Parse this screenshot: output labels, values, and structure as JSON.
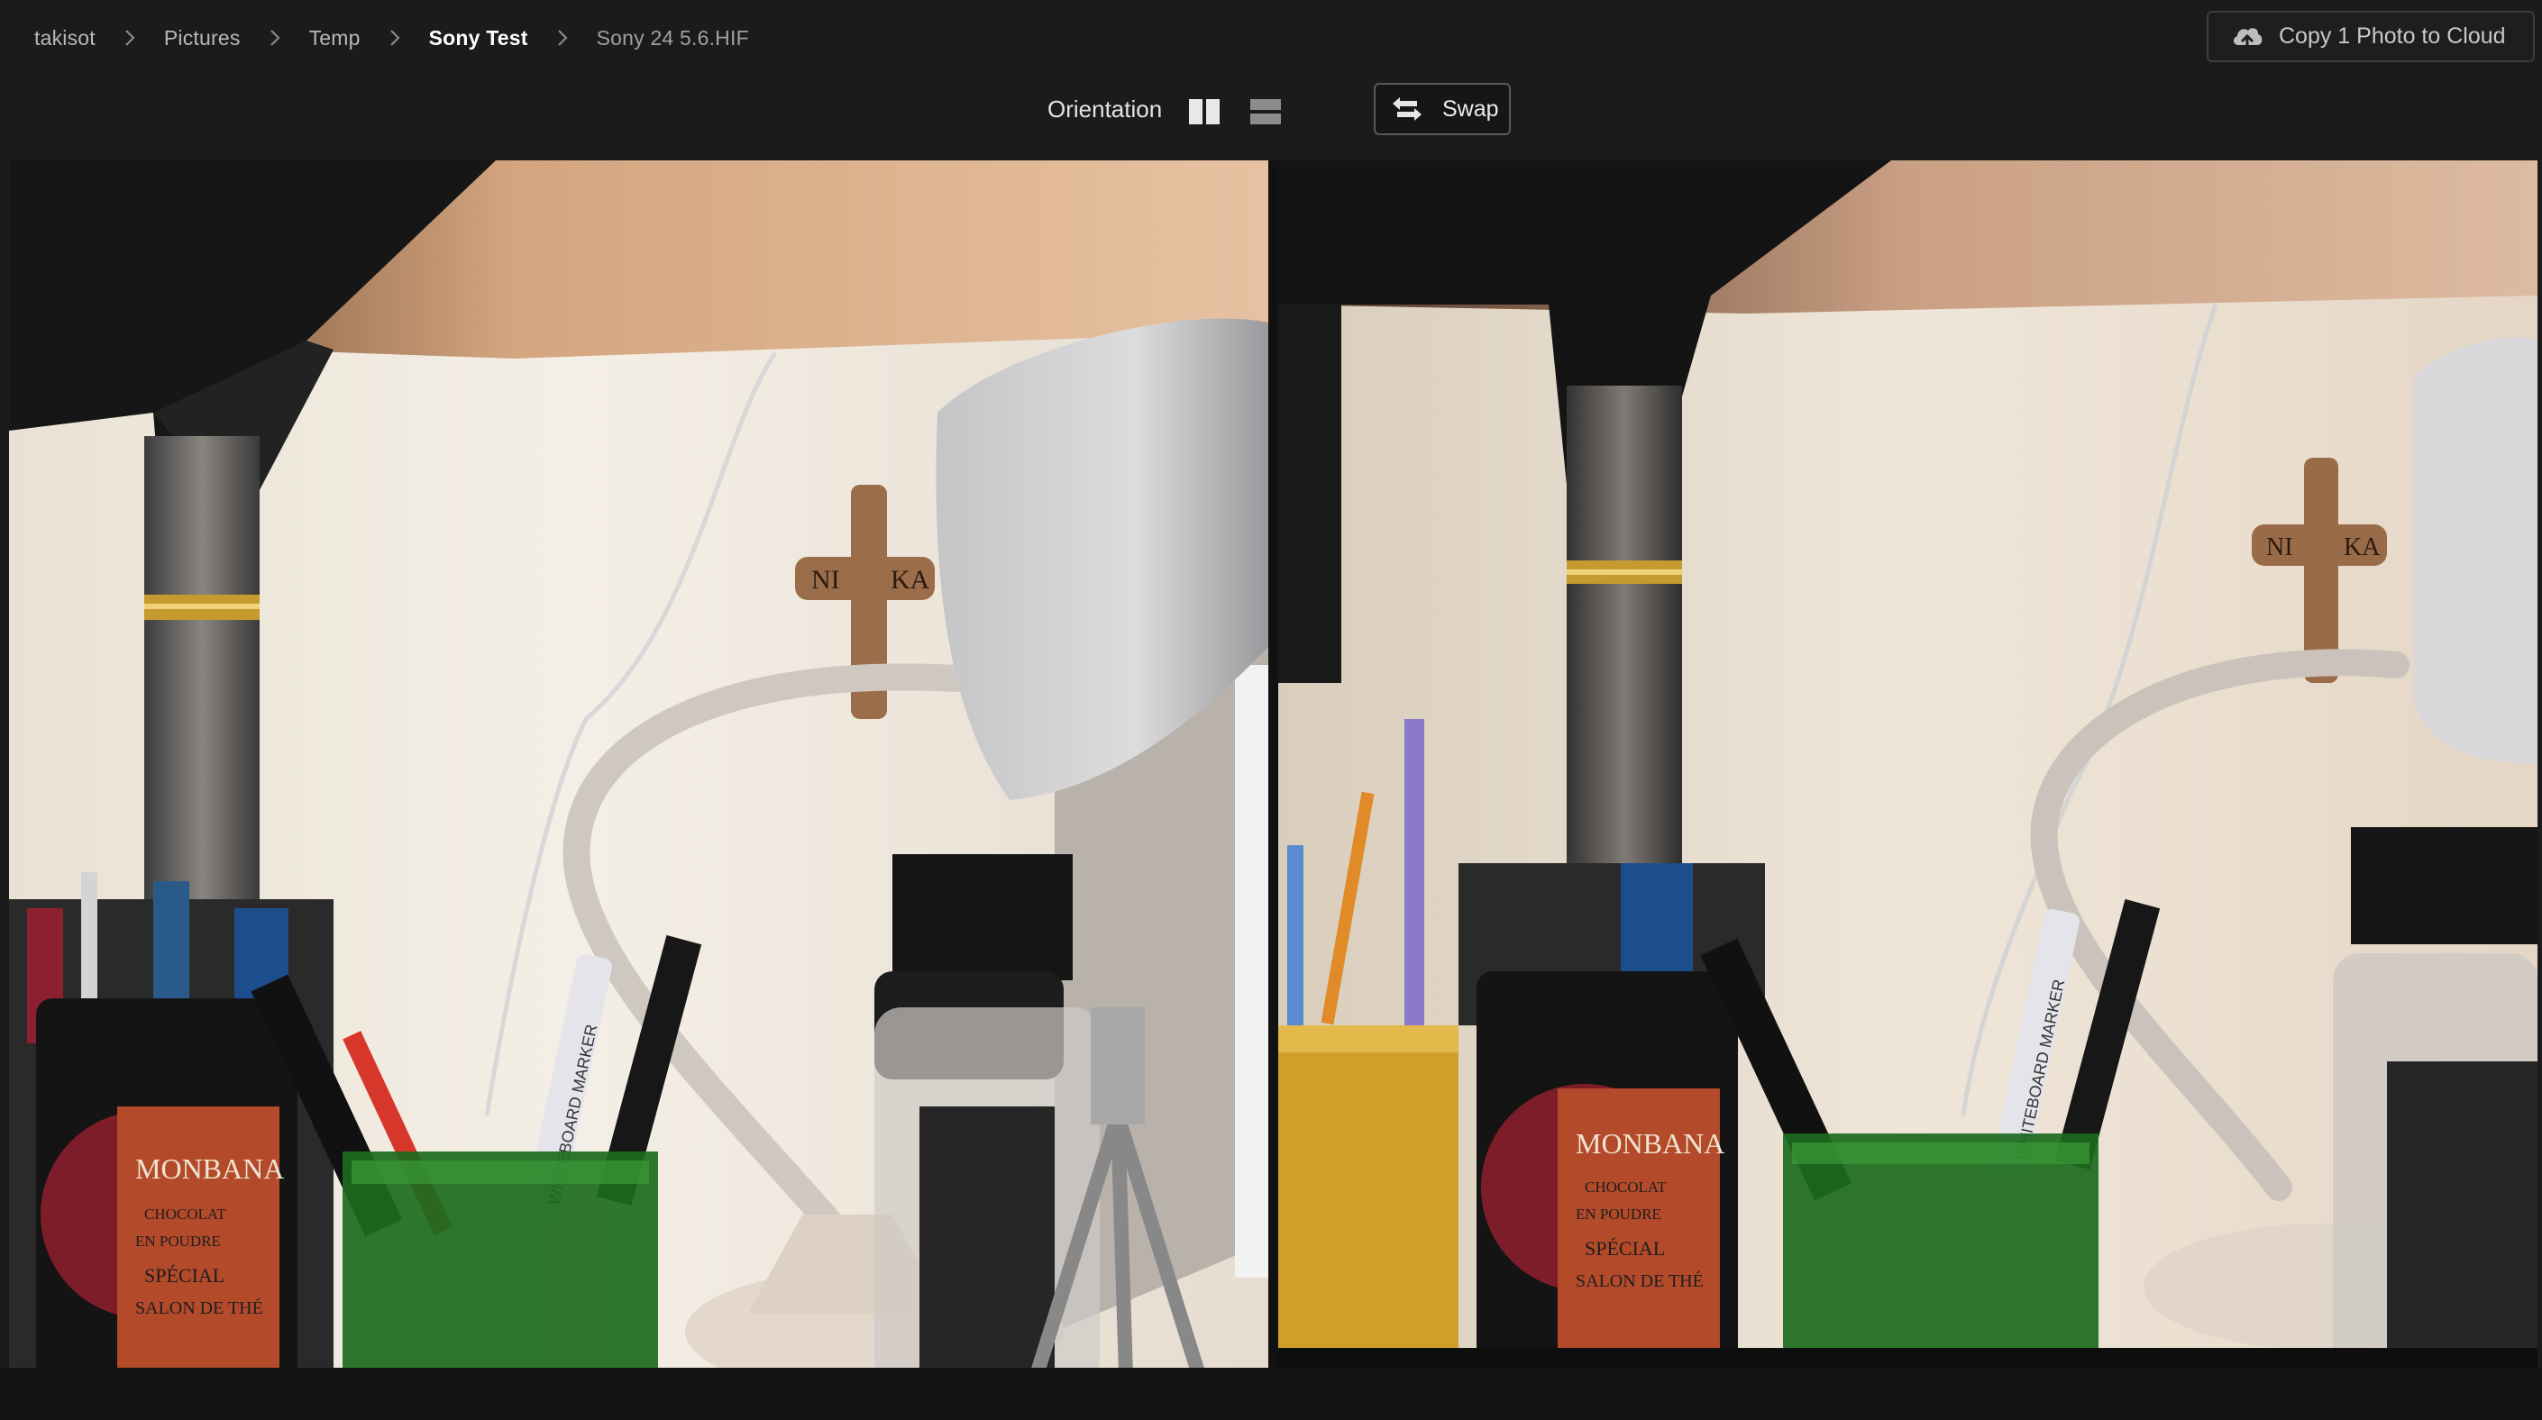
{
  "breadcrumb": {
    "items": [
      {
        "label": "takisot"
      },
      {
        "label": "Pictures"
      },
      {
        "label": "Temp"
      },
      {
        "label": "Sony Test"
      },
      {
        "label": "Sony 24 5.6.HIF"
      }
    ]
  },
  "cloud_button": {
    "label": "Copy 1 Photo to Cloud",
    "icon": "cloud-upload-icon"
  },
  "toolbar": {
    "orientation_label": "Orientation",
    "orientation_selected": "side-by-side",
    "orientation_options": [
      "side-by-side",
      "stacked"
    ],
    "swap_label": "Swap"
  },
  "photo_labels": {
    "chocolate_brand": "MONBANA",
    "chocolate_line1": "CHOCOLAT",
    "chocolate_line2": "EN POUDRE",
    "chocolate_line3": "SPÉCIAL",
    "chocolate_line4": "SALON DE THÉ",
    "marker_text": "WHITEBOARD MARKER",
    "cross_text_left": "NI",
    "cross_text_right": "KA"
  },
  "colors": {
    "background": "#1b1b1b",
    "accent_text": "#ffffff",
    "muted_text": "#b8b8b8",
    "button_border": "#3d3d3d"
  }
}
